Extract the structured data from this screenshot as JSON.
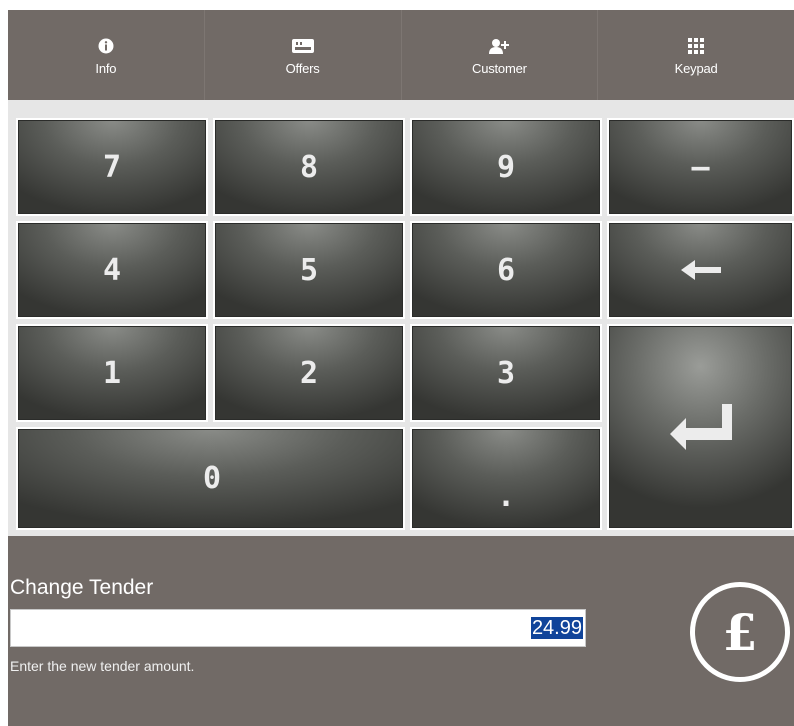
{
  "tabs": [
    {
      "label": "Info",
      "icon": "info-icon"
    },
    {
      "label": "Offers",
      "icon": "offers-icon"
    },
    {
      "label": "Customer",
      "icon": "add-customer-icon"
    },
    {
      "label": "Keypad",
      "icon": "keypad-icon",
      "active": true
    }
  ],
  "keypad": {
    "k7": "7",
    "k8": "8",
    "k9": "9",
    "minus": "–",
    "k4": "4",
    "k5": "5",
    "k6": "6",
    "k1": "1",
    "k2": "2",
    "k3": "3",
    "k0": "0",
    "dot": ".",
    "backspace_icon": "backspace-arrow-icon",
    "enter_icon": "enter-return-icon"
  },
  "tender": {
    "title": "Change Tender",
    "value": "24.99",
    "hint": "Enter the new tender amount.",
    "currency_symbol": "£"
  },
  "colors": {
    "panel": "#716a66",
    "key_light": "#8a8c88",
    "key_dark": "#353633",
    "selection": "#10449a"
  }
}
